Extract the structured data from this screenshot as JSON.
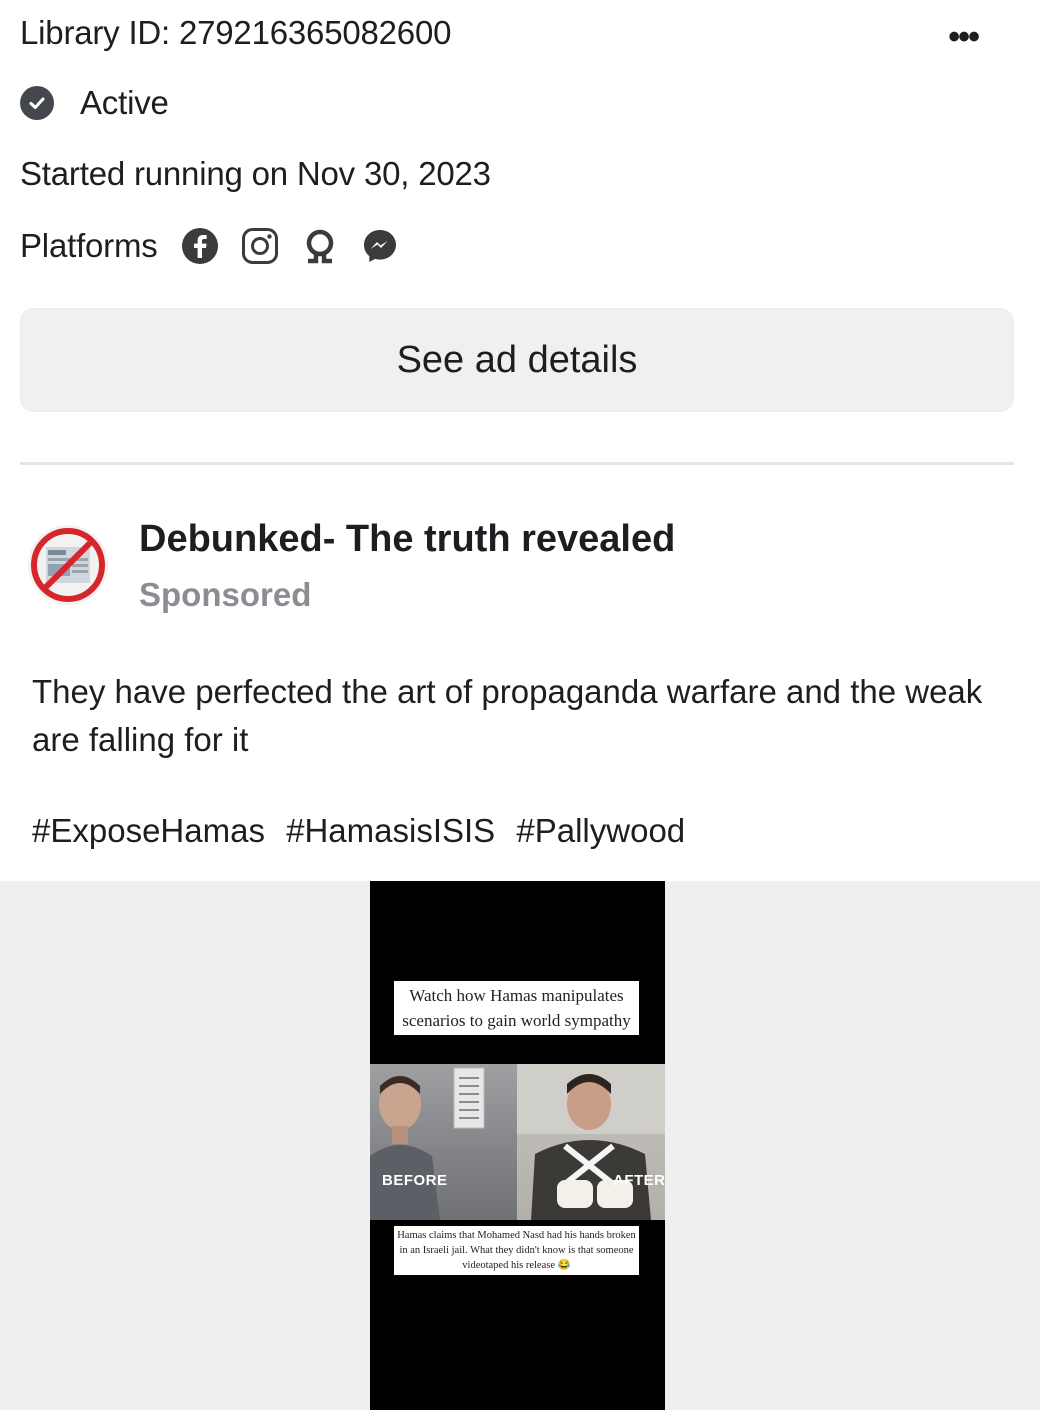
{
  "library": {
    "id_text": "Library ID: 279216365082600",
    "more_label": "•••"
  },
  "status": {
    "label": "Active",
    "icon": "check-circle-icon"
  },
  "started": {
    "text": "Started running on Nov 30, 2023"
  },
  "platforms": {
    "label": "Platforms",
    "icons": [
      "facebook-icon",
      "instagram-icon",
      "audience-network-icon",
      "messenger-icon"
    ]
  },
  "details_button": {
    "label": "See ad details"
  },
  "ad": {
    "page_name": "Debunked- The truth revealed",
    "sponsored": "Sponsored",
    "body": "They have perfected the art of propaganda warfare and the weak are falling for it",
    "hashtags": [
      "#ExposeHamas",
      "#HamasisISIS",
      "#Pallywood"
    ]
  },
  "video": {
    "caption_top": "Watch how Hamas manipulates scenarios to gain world sympathy",
    "label_before": "BEFORE",
    "label_after": "AFTER",
    "caption_bottom": "Hamas claims that Mohamed Nasd had his hands broken in an Israeli jail. What they didn't know is that someone videotaped his release 😂"
  },
  "colors": {
    "muted_text": "#8a8d91",
    "button_bg": "#f0f0f0",
    "media_bg": "#efefef"
  }
}
